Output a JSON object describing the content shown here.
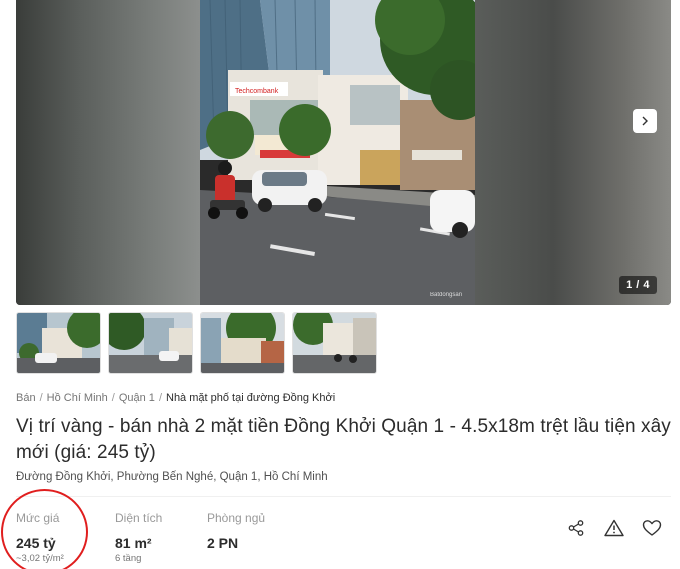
{
  "gallery": {
    "counter": "1 / 4",
    "watermark": "Batdongsan",
    "shop_sign": "Techcombank",
    "next_icon": "chevron-right-icon"
  },
  "thumbnails": [
    {
      "label": "thumbnail 1"
    },
    {
      "label": "thumbnail 2"
    },
    {
      "label": "thumbnail 3"
    },
    {
      "label": "thumbnail 4"
    }
  ],
  "breadcrumb": {
    "items": [
      "Bán",
      "Hồ Chí Minh",
      "Quận 1"
    ],
    "current": "Nhà mặt phố tại đường Đồng Khởi",
    "separator": "/"
  },
  "listing": {
    "title": "Vị trí vàng - bán nhà 2 mặt tiền Đồng Khởi Quận 1 - 4.5x18m trệt lầu tiện xây mới (giá: 245 tỷ)",
    "address": "Đường Đồng Khởi, Phường Bến Nghé, Quận 1, Hồ Chí Minh"
  },
  "specs": {
    "price": {
      "label": "Mức giá",
      "value": "245 tỷ",
      "sub": "~3,02 tỷ/m²"
    },
    "area": {
      "label": "Diện tích",
      "value": "81 m²",
      "sub": "6 tầng"
    },
    "bedrooms": {
      "label": "Phòng ngủ",
      "value": "2 PN"
    }
  },
  "actions": [
    "share-icon",
    "report-warning-icon",
    "heart-icon"
  ],
  "colors": {
    "annotation_circle": "#e01e1e",
    "text": "#2c2c2c",
    "muted": "#999999"
  }
}
